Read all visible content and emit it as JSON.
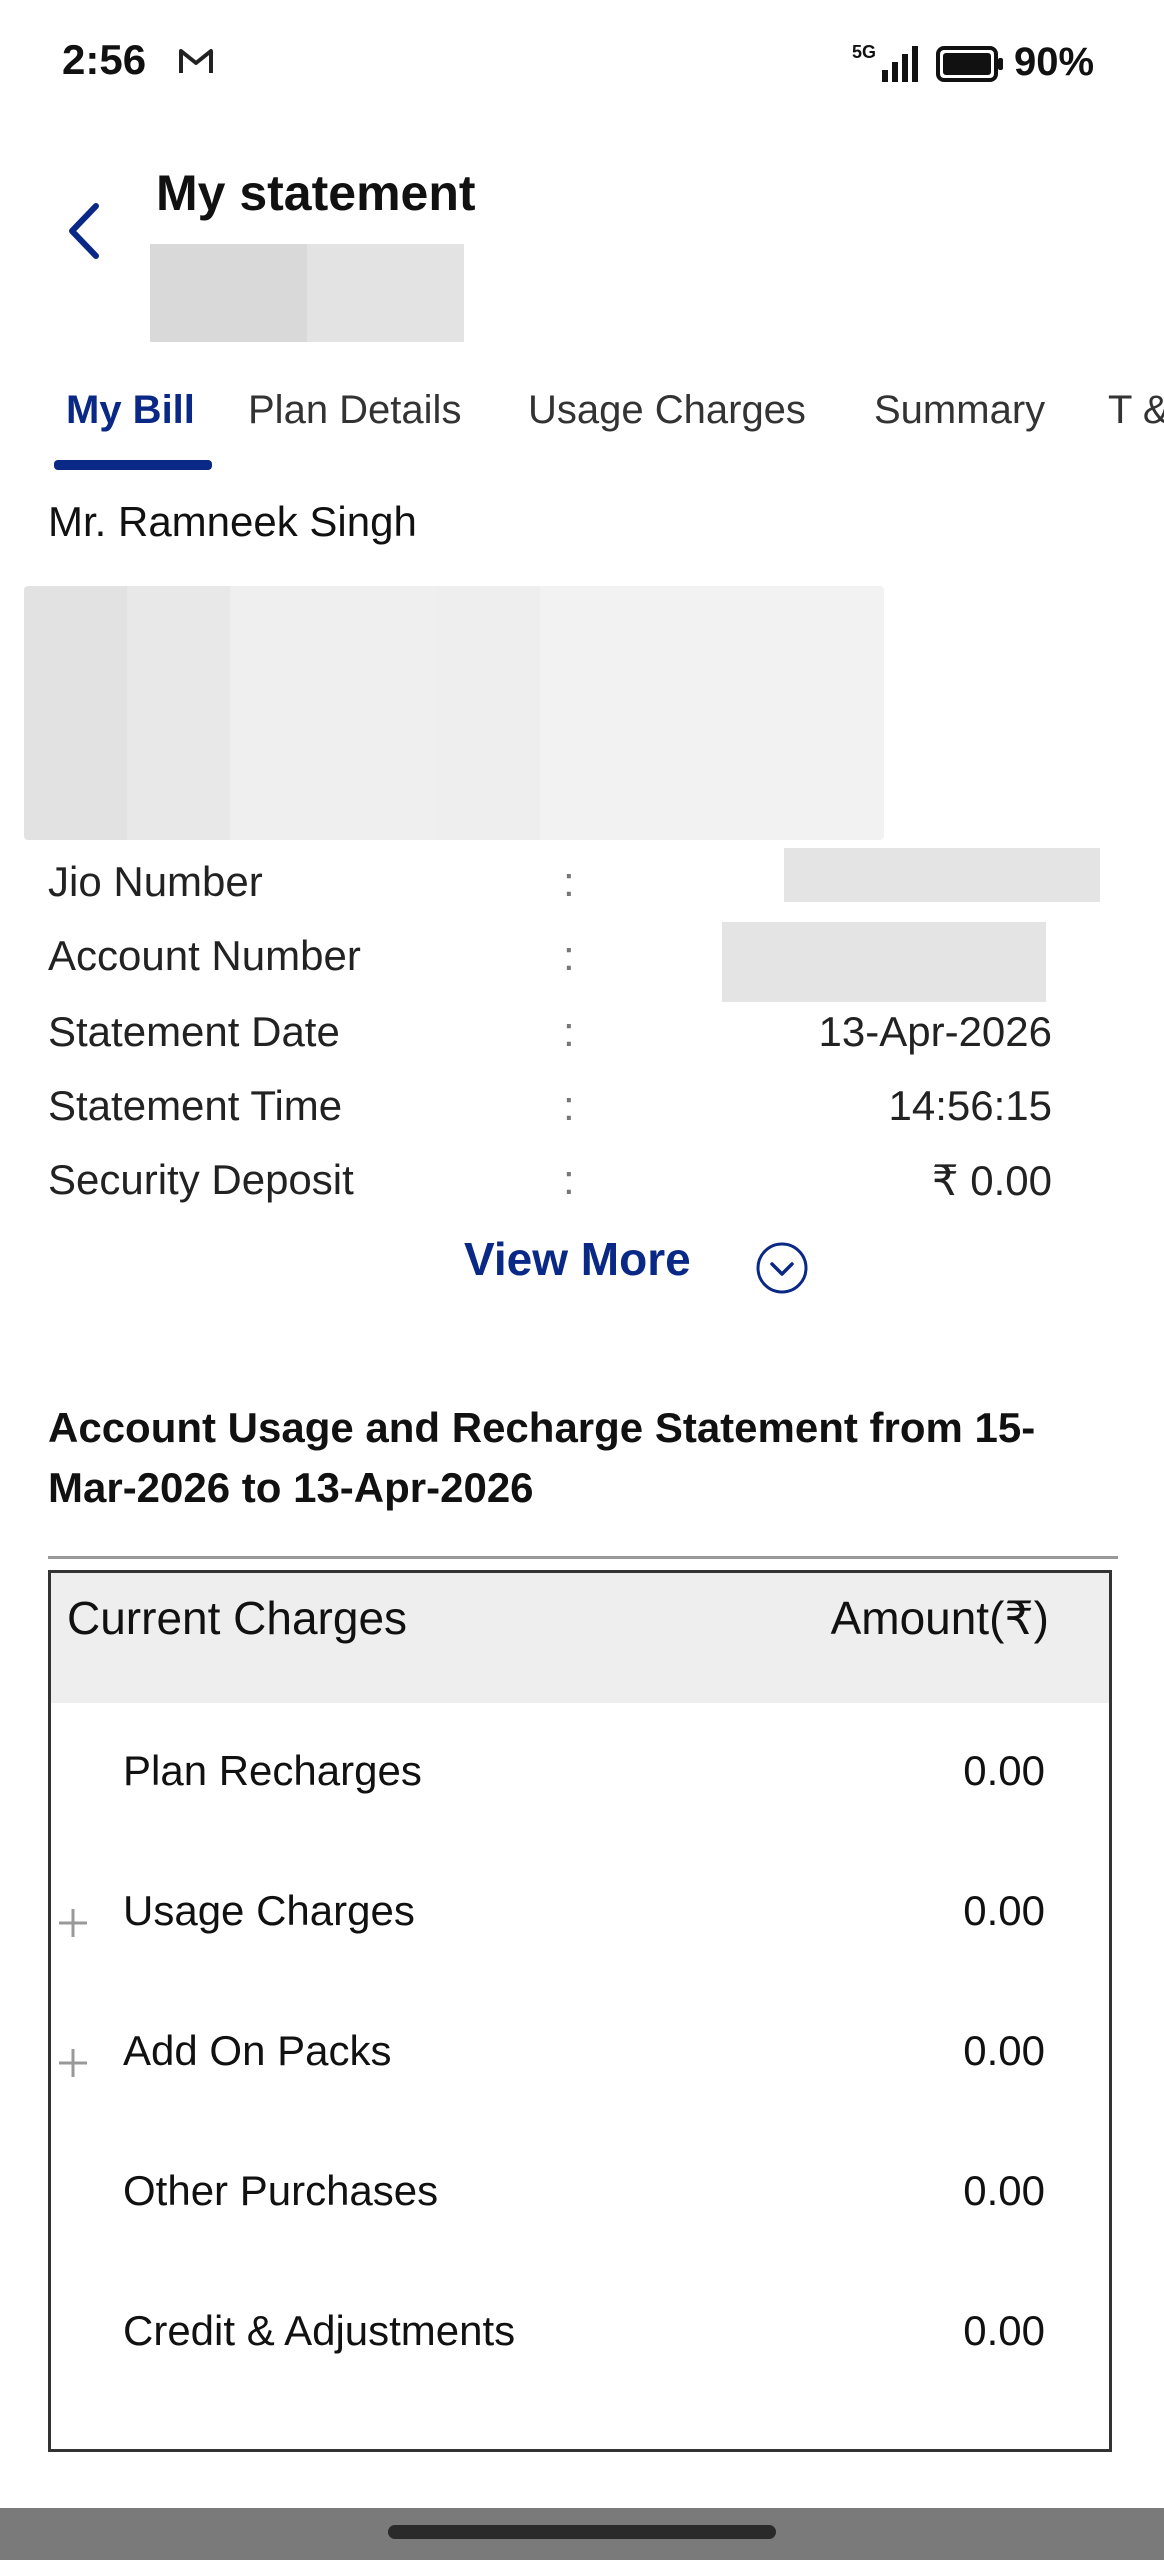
{
  "status_bar": {
    "time": "2:56",
    "network": "5G",
    "battery": "90%"
  },
  "header": {
    "title": "My statement"
  },
  "tabs": [
    {
      "label": "My Bill"
    },
    {
      "label": "Plan Details"
    },
    {
      "label": "Usage Charges"
    },
    {
      "label": "Summary"
    },
    {
      "label": "T &"
    }
  ],
  "customer": {
    "name": "Mr. Ramneek Singh"
  },
  "info": [
    {
      "label": "Jio Number",
      "value": ""
    },
    {
      "label": "Account Number",
      "value": ""
    },
    {
      "label": "Statement Date",
      "value": "13-Apr-2026"
    },
    {
      "label": "Statement Time",
      "value": "14:56:15"
    },
    {
      "label": "Security Deposit",
      "value": "₹ 0.00"
    }
  ],
  "view_more": "View More",
  "statement": {
    "heading": "Account Usage and Recharge Statement from 15-Mar-2026 to 13-Apr-2026"
  },
  "charges_table": {
    "header_left": "Current Charges",
    "header_right": "Amount(₹)",
    "rows": [
      {
        "label": "Plan Recharges",
        "amount": "0.00"
      },
      {
        "label": "Usage Charges",
        "amount": "0.00"
      },
      {
        "label": "Add On Packs",
        "amount": "0.00"
      },
      {
        "label": "Other Purchases",
        "amount": "0.00"
      },
      {
        "label": "Credit & Adjustments",
        "amount": "0.00"
      }
    ]
  },
  "colors": {
    "accent": "#0a2885",
    "header_bg": "#eeeeee",
    "border": "#333333"
  }
}
